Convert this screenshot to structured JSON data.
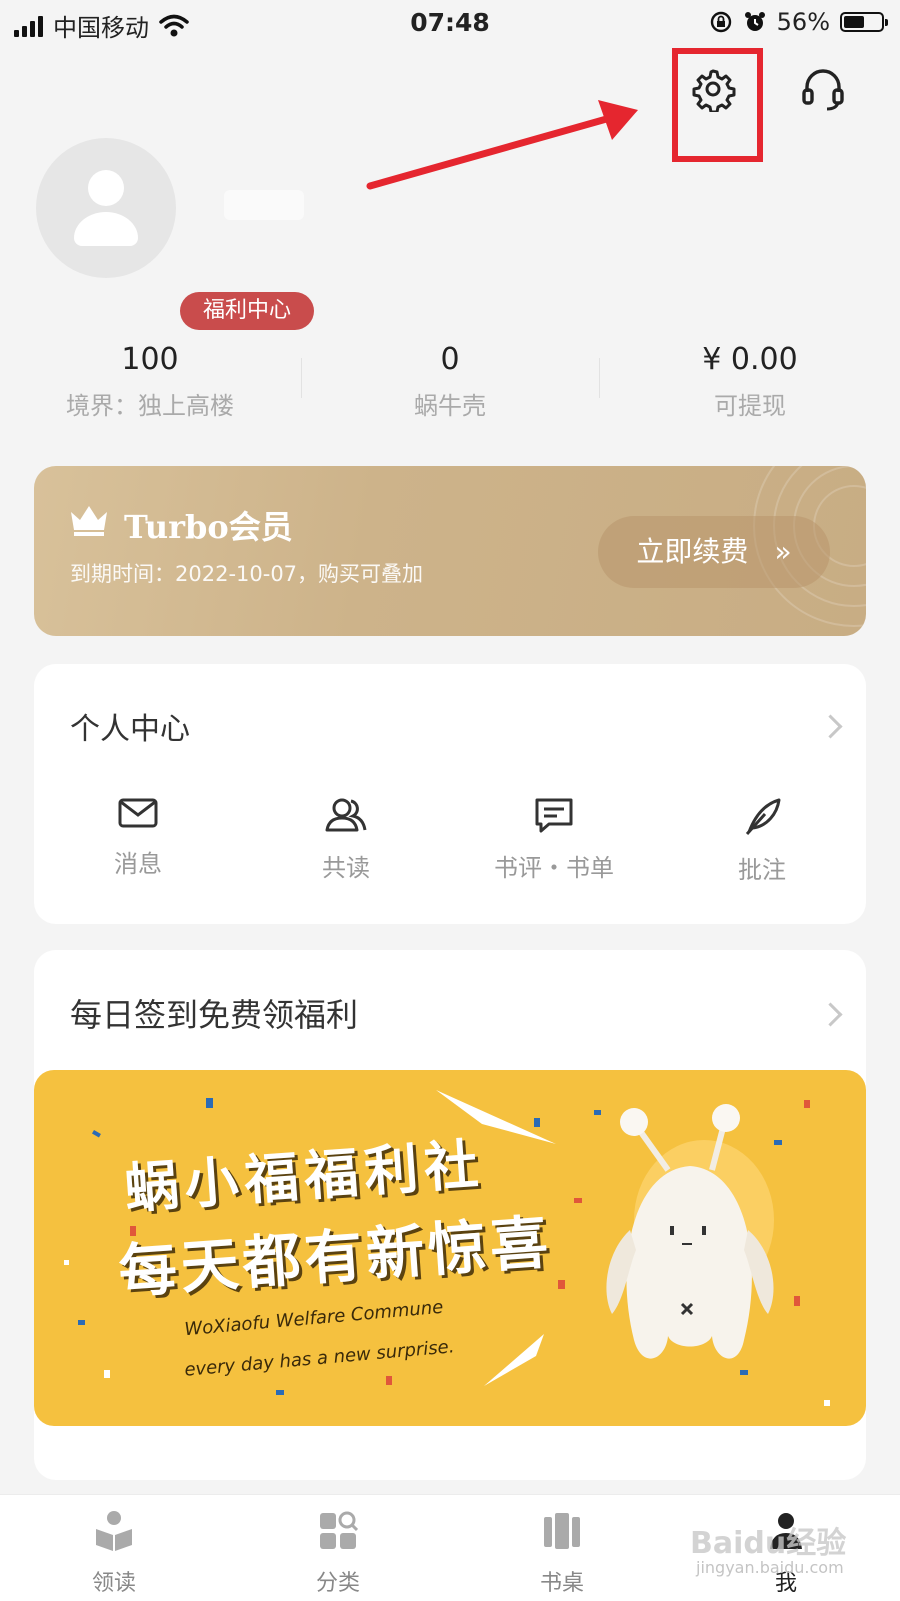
{
  "status_bar": {
    "carrier": "中国移动",
    "time": "07:48",
    "battery": "56%",
    "battery_level": 0.56
  },
  "profile": {
    "welfare_badge": "福利中心"
  },
  "stats": [
    {
      "value": "100",
      "label": "境界：独上高楼"
    },
    {
      "value": "0",
      "label": "蜗牛壳"
    },
    {
      "value": "¥ 0.00",
      "label": "可提现"
    }
  ],
  "vip": {
    "title": "Turbo会员",
    "subtitle": "到期时间：2022-10-07，购买可叠加",
    "renew_label": "立即续费",
    "renew_arrow": "»"
  },
  "personal_center": {
    "title": "个人中心",
    "items": [
      {
        "label": "消息",
        "icon": "mail-icon"
      },
      {
        "label": "共读",
        "icon": "people-icon"
      },
      {
        "label": "书评・书单",
        "icon": "comment-icon"
      },
      {
        "label": "批注",
        "icon": "feather-icon"
      }
    ]
  },
  "checkin": {
    "title": "每日签到免费领福利"
  },
  "banner": {
    "line1": "蜗小福福利社",
    "line2": "每天都有新惊喜",
    "en1": "WoXiaofu Welfare Commune",
    "en2": "every day has a new surprise."
  },
  "tabs": [
    {
      "label": "领读",
      "icon": "book-reader-icon"
    },
    {
      "label": "分类",
      "icon": "category-icon"
    },
    {
      "label": "书桌",
      "icon": "bookshelf-icon"
    },
    {
      "label": "我",
      "icon": "person-icon",
      "active": true
    }
  ],
  "watermark": {
    "main": "Baidu经验",
    "sub": "jingyan.baidu.com"
  },
  "colors": {
    "annotation_red": "#e5262f",
    "badge_red": "#c94c4c",
    "vip_gold": "#cdb38a",
    "banner_yellow": "#f5c13f"
  }
}
